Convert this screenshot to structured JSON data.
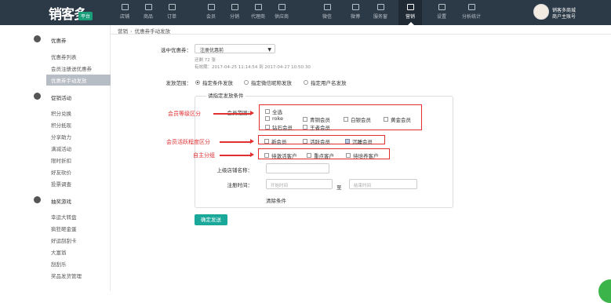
{
  "brand": {
    "name": "销客多",
    "badge": "平台"
  },
  "nav": [
    {
      "label": "店铺"
    },
    {
      "label": "商品"
    },
    {
      "label": "订单"
    },
    {
      "label": "会员"
    },
    {
      "label": "分销"
    },
    {
      "label": "代理商"
    },
    {
      "label": "供应商"
    },
    {
      "label": "微信"
    },
    {
      "label": "微博"
    },
    {
      "label": "服务窗"
    },
    {
      "label": "营销"
    },
    {
      "label": "设置"
    },
    {
      "label": "分析统计"
    }
  ],
  "user": {
    "name": "销客多商城",
    "role": "商户主账号"
  },
  "sidebar": {
    "groups": [
      {
        "title": "优惠券",
        "icon": "coupon-icon",
        "items": [
          "优惠券列表",
          "会员注册送优惠券",
          "优惠券手动发放"
        ]
      },
      {
        "title": "促销活动",
        "icon": "promotion-icon",
        "items": [
          "积分兑换",
          "积分抵现",
          "分享助力",
          "满减活动",
          "限时折扣",
          "好友砍价",
          "投票调查"
        ]
      },
      {
        "title": "抽奖游戏",
        "icon": "game-icon",
        "items": [
          "幸运大转盘",
          "疯狂砸金蛋",
          "好运刮刮卡",
          "大富翁",
          "刮刮乐",
          "奖品发货管理"
        ]
      }
    ],
    "active_item": "优惠券手动发放"
  },
  "breadcrumb": {
    "root": "营销",
    "current": "优惠券手动发放"
  },
  "form": {
    "coupon_label": "选中优惠券：",
    "coupon_selected": "注册优惠前",
    "remaining": "还剩 72 张",
    "validity": "有效期：2017-04-25 11:14:54 到 2017-04-27 10:50:30",
    "scope_label": "发放范围：",
    "scope_options": [
      "指定条件发放",
      "指定微信昵称发放",
      "指定用户名发放"
    ],
    "conditions_legend": "请指定发放条件",
    "member_level_label": "会员范围：",
    "member_levels": [
      "全选",
      "roke",
      "青铜会员",
      "白银会员",
      "黄金会员",
      "钻石会员",
      "王者会员"
    ],
    "activity_levels": [
      "新会员",
      "活跃会员",
      "沉睡会员"
    ],
    "groups": [
      "待激活客户",
      "重点客户",
      "待培养客户"
    ],
    "store_label": "上级店铺名称：",
    "regtime_label": "注册时间：",
    "start_placeholder": "开始时间",
    "to_label": "至",
    "end_placeholder": "结束时间",
    "clear_label": "清除条件",
    "submit_label": "确定发送"
  },
  "annotations": {
    "level": "会员等级区分",
    "activity": "会员活跃程度区分",
    "group": "自主分组"
  },
  "colors": {
    "topbar": "#2c3a47",
    "accent": "#1aa89b",
    "annotation": "#e03030"
  }
}
